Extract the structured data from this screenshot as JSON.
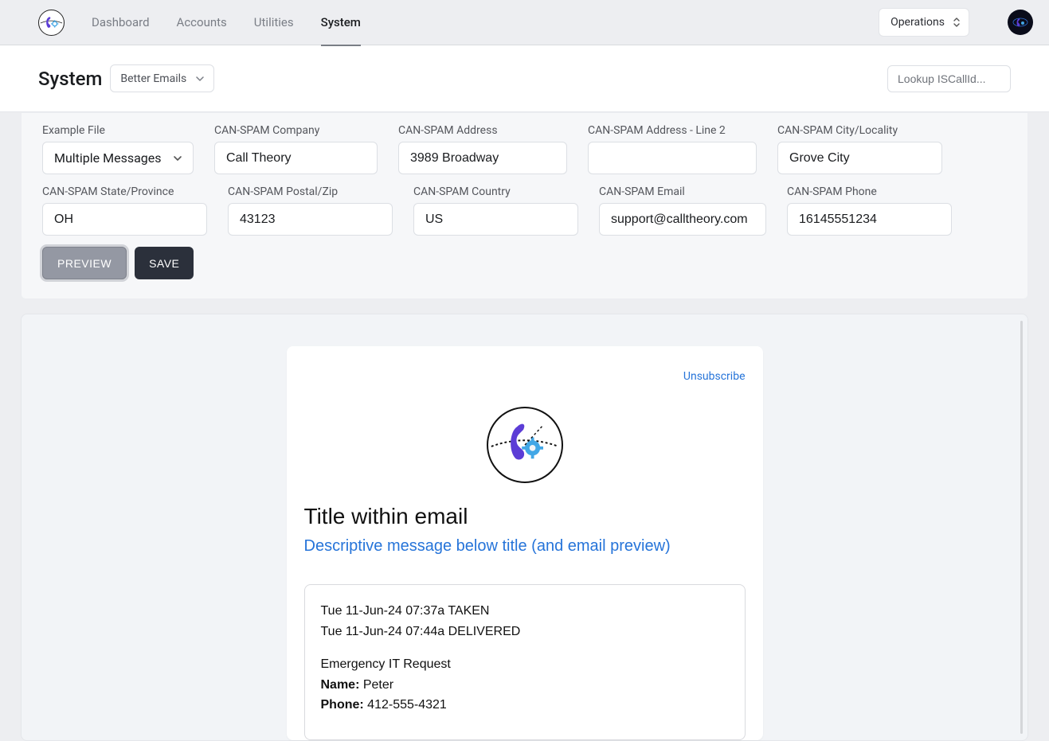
{
  "nav": {
    "items": [
      "Dashboard",
      "Accounts",
      "Utilities",
      "System"
    ],
    "active_index": 3,
    "ops_label": "Operations"
  },
  "subheader": {
    "title": "System",
    "dropdown_label": "Better Emails",
    "lookup_placeholder": "Lookup ISCallId..."
  },
  "form": {
    "row1": {
      "example_file": {
        "label": "Example File",
        "value": "Multiple Messages"
      },
      "company": {
        "label": "CAN-SPAM Company",
        "value": "Call Theory"
      },
      "address": {
        "label": "CAN-SPAM Address",
        "value": "3989 Broadway"
      },
      "address2": {
        "label": "CAN-SPAM Address - Line 2",
        "value": ""
      },
      "city": {
        "label": "CAN-SPAM City/Locality",
        "value": "Grove City"
      }
    },
    "row2": {
      "state": {
        "label": "CAN-SPAM State/Province",
        "value": "OH"
      },
      "postal": {
        "label": "CAN-SPAM Postal/Zip",
        "value": "43123"
      },
      "country": {
        "label": "CAN-SPAM Country",
        "value": "US"
      },
      "email": {
        "label": "CAN-SPAM Email",
        "value": "support@calltheory.com"
      },
      "phone": {
        "label": "CAN-SPAM Phone",
        "value": "16145551234"
      }
    },
    "buttons": {
      "preview": "PREVIEW",
      "save": "SAVE"
    }
  },
  "email": {
    "unsubscribe": "Unsubscribe",
    "title": "Title within email",
    "subtitle": "Descriptive message below title (and email preview)",
    "msg": {
      "line1": "Tue 11-Jun-24 07:37a TAKEN",
      "line2": "Tue 11-Jun-24 07:44a DELIVERED",
      "line3": "Emergency IT Request",
      "name_label": "Name:",
      "name_value": " Peter",
      "phone_label": "Phone:",
      "phone_value": " 412-555-4321"
    }
  }
}
